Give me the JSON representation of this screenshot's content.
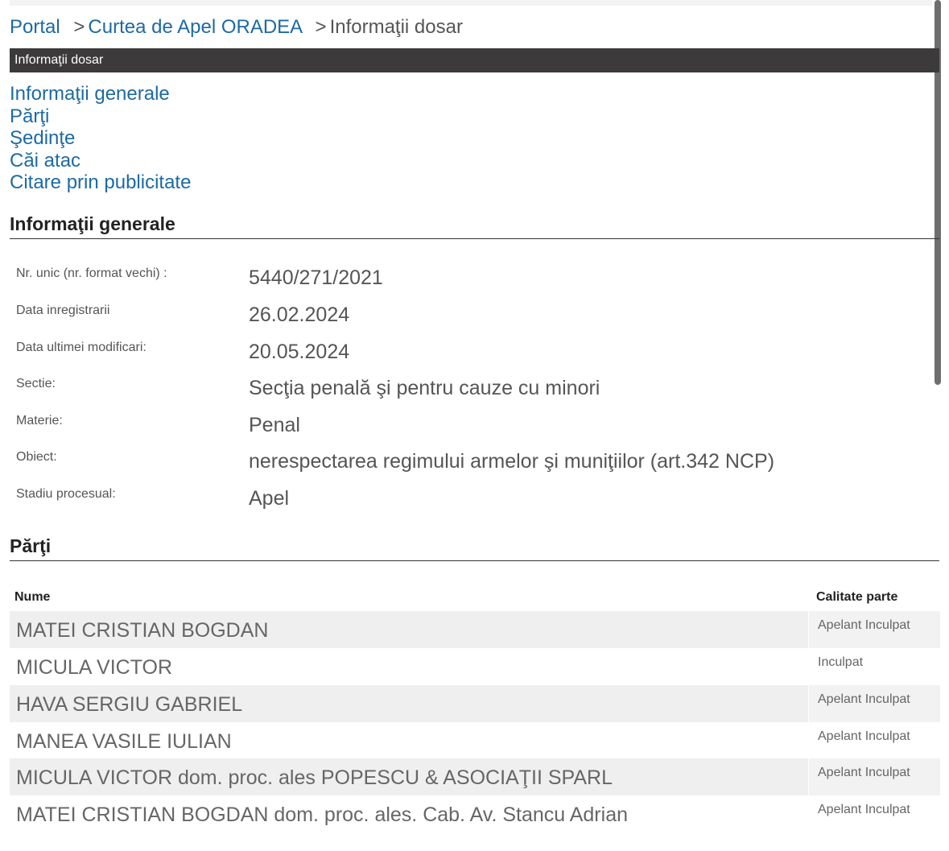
{
  "breadcrumb": {
    "portal": "Portal",
    "sep1": ">",
    "court": "Curtea de Apel ORADEA",
    "sep2": ">",
    "current": "Informaţii dosar"
  },
  "titlebar": "Informaţii dosar",
  "nav": [
    "Informaţii generale",
    "Părţi",
    "Şedinţe",
    "Căi atac",
    "Citare prin publicitate"
  ],
  "general": {
    "title": "Informaţii generale",
    "rows": [
      {
        "label": "Nr. unic (nr. format vechi) :",
        "value": "5440/271/2021"
      },
      {
        "label": "Data inregistrarii",
        "value": "26.02.2024"
      },
      {
        "label": "Data ultimei modificari:",
        "value": "20.05.2024"
      },
      {
        "label": "Sectie:",
        "value": "Secţia penală şi pentru cauze cu minori"
      },
      {
        "label": "Materie:",
        "value": "Penal"
      },
      {
        "label": "Obiect:",
        "value": "nerespectarea regimului armelor şi muniţiilor (art.342 NCP)"
      },
      {
        "label": "Stadiu procesual:",
        "value": "Apel"
      }
    ]
  },
  "parties": {
    "title": "Părţi",
    "col_name": "Nume",
    "col_quality": "Calitate parte",
    "rows": [
      {
        "name": "MATEI CRISTIAN BOGDAN",
        "quality": "Apelant Inculpat"
      },
      {
        "name": "MICULA VICTOR",
        "quality": "Inculpat"
      },
      {
        "name": "HAVA SERGIU GABRIEL",
        "quality": "Apelant Inculpat"
      },
      {
        "name": "MANEA VASILE IULIAN",
        "quality": "Apelant Inculpat"
      },
      {
        "name": "MICULA VICTOR dom. proc. ales POPESCU & ASOCIAŢII SPARL",
        "quality": "Apelant Inculpat"
      },
      {
        "name": "MATEI CRISTIAN BOGDAN dom. proc. ales. Cab. Av. Stancu Adrian",
        "quality": "Apelant Inculpat"
      }
    ]
  }
}
